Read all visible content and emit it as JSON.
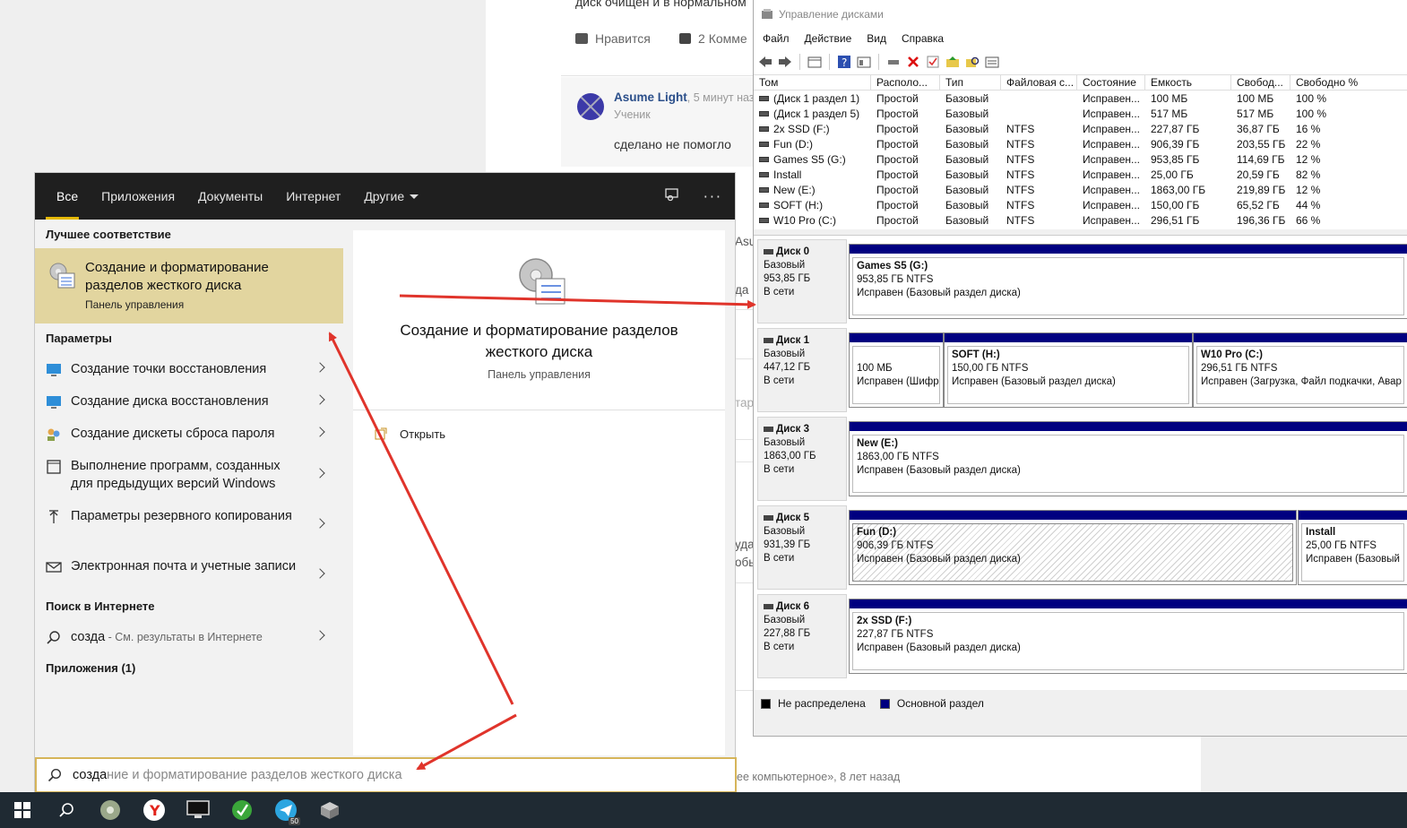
{
  "background_page": {
    "top_text": "диск очищен и в нормальном",
    "like_label": "Нравится",
    "comments_count": "2",
    "comments_label": "Комме",
    "comment_author": "Asume Light",
    "comment_time": ", 5 минут наз",
    "comment_role": "Ученик",
    "comment_text": "сделано не помогло",
    "partial_1": "Asu",
    "partial_2": "да",
    "partial_3": "тар",
    "partial_4": "уда",
    "partial_5": "обь",
    "footer_text": "ее компьютерное», 8 лет назад"
  },
  "start_menu": {
    "tabs": [
      {
        "label": "Все",
        "active": true
      },
      {
        "label": "Приложения"
      },
      {
        "label": "Документы"
      },
      {
        "label": "Интернет"
      },
      {
        "label": "Другие"
      }
    ],
    "best_match_title": "Лучшее соответствие",
    "best_match": {
      "title": "Создание и форматирование разделов жесткого диска",
      "subtitle": "Панель управления"
    },
    "settings_title": "Параметры",
    "settings_items": [
      {
        "label": "Создание точки восстановления",
        "icon": "monitor-icon"
      },
      {
        "label": "Создание диска восстановления",
        "icon": "monitor-icon"
      },
      {
        "label": "Создание дискеты сброса пароля",
        "icon": "users-icon"
      },
      {
        "label": "Выполнение программ, созданных для предыдущих версий Windows",
        "icon": "window-icon"
      },
      {
        "label": "Параметры резервного копирования",
        "icon": "upload-icon"
      },
      {
        "label": "Электронная почта и учетные записи",
        "icon": "mail-icon"
      }
    ],
    "web_title": "Поиск в Интернете",
    "web_query": "созда",
    "web_hint": " - См. результаты в Интернете",
    "apps_title": "Приложения (1)",
    "preview": {
      "title": "Создание и форматирование разделов жесткого диска",
      "subtitle": "Панель управления",
      "open_label": "Открыть"
    },
    "search": {
      "typed": "созда",
      "suggested": "ние и форматирование разделов жесткого диска"
    }
  },
  "disk_mgmt": {
    "title": "Управление дисками",
    "menu": [
      "Файл",
      "Действие",
      "Вид",
      "Справка"
    ],
    "columns": [
      "Том",
      "Располо...",
      "Тип",
      "Файловая с...",
      "Состояние",
      "Емкость",
      "Свобод...",
      "Свободно %"
    ],
    "volumes": [
      [
        "(Диск 1 раздел 1)",
        "Простой",
        "Базовый",
        "",
        "Исправен...",
        "100 МБ",
        "100 МБ",
        "100 %"
      ],
      [
        "(Диск 1 раздел 5)",
        "Простой",
        "Базовый",
        "",
        "Исправен...",
        "517 МБ",
        "517 МБ",
        "100 %"
      ],
      [
        "2x SSD (F:)",
        "Простой",
        "Базовый",
        "NTFS",
        "Исправен...",
        "227,87 ГБ",
        "36,87 ГБ",
        "16 %"
      ],
      [
        "Fun (D:)",
        "Простой",
        "Базовый",
        "NTFS",
        "Исправен...",
        "906,39 ГБ",
        "203,55 ГБ",
        "22 %"
      ],
      [
        "Games S5 (G:)",
        "Простой",
        "Базовый",
        "NTFS",
        "Исправен...",
        "953,85 ГБ",
        "114,69 ГБ",
        "12 %"
      ],
      [
        "Install",
        "Простой",
        "Базовый",
        "NTFS",
        "Исправен...",
        "25,00 ГБ",
        "20,59 ГБ",
        "82 %"
      ],
      [
        "New (E:)",
        "Простой",
        "Базовый",
        "NTFS",
        "Исправен...",
        "1863,00 ГБ",
        "219,89 ГБ",
        "12 %"
      ],
      [
        "SOFT (H:)",
        "Простой",
        "Базовый",
        "NTFS",
        "Исправен...",
        "150,00 ГБ",
        "65,52 ГБ",
        "44 %"
      ],
      [
        "W10 Pro (C:)",
        "Простой",
        "Базовый",
        "NTFS",
        "Исправен...",
        "296,51 ГБ",
        "196,36 ГБ",
        "66 %"
      ]
    ],
    "disks": [
      {
        "name": "Диск 0",
        "type": "Базовый",
        "size": "953,85 ГБ",
        "status": "В сети",
        "parts": [
          {
            "name": "Games S5  (G:)",
            "size": "953,85 ГБ NTFS",
            "state": "Исправен (Базовый раздел диска)"
          }
        ]
      },
      {
        "name": "Диск 1",
        "type": "Базовый",
        "size": "447,12 ГБ",
        "status": "В сети",
        "parts": [
          {
            "name": "",
            "size": "100 МБ",
            "state": "Исправен (Шифр"
          },
          {
            "name": "SOFT  (H:)",
            "size": "150,00 ГБ NTFS",
            "state": "Исправен (Базовый раздел диска)"
          },
          {
            "name": "W10 Pro  (C:)",
            "size": "296,51 ГБ NTFS",
            "state": "Исправен (Загрузка, Файл подкачки, Авар"
          }
        ]
      },
      {
        "name": "Диск 3",
        "type": "Базовый",
        "size": "1863,00 ГБ",
        "status": "В сети",
        "parts": [
          {
            "name": "New  (E:)",
            "size": "1863,00 ГБ NTFS",
            "state": "Исправен (Базовый раздел диска)"
          }
        ]
      },
      {
        "name": "Диск 5",
        "type": "Базовый",
        "size": "931,39 ГБ",
        "status": "В сети",
        "parts": [
          {
            "name": "Fun  (D:)",
            "size": "906,39 ГБ NTFS",
            "state": "Исправен (Базовый раздел диска)"
          },
          {
            "name": "Install",
            "size": "25,00 ГБ NTFS",
            "state": "Исправен (Базовый"
          }
        ]
      },
      {
        "name": "Диск 6",
        "type": "Базовый",
        "size": "227,88 ГБ",
        "status": "В сети",
        "parts": [
          {
            "name": "2x SSD  (F:)",
            "size": "227,87 ГБ NTFS",
            "state": "Исправен (Базовый раздел диска)"
          }
        ]
      }
    ],
    "legend": [
      "Не распределена",
      "Основной раздел"
    ],
    "colors": {
      "primary_partition": "#000080",
      "unallocated": "#000000"
    }
  },
  "taskbar": {
    "telegram_badge": "50"
  },
  "colors": {
    "accent": "#e5b900",
    "best_match_bg": "#e2d59f",
    "arrow": "#e0342b",
    "taskbar": "#1f2a33"
  }
}
